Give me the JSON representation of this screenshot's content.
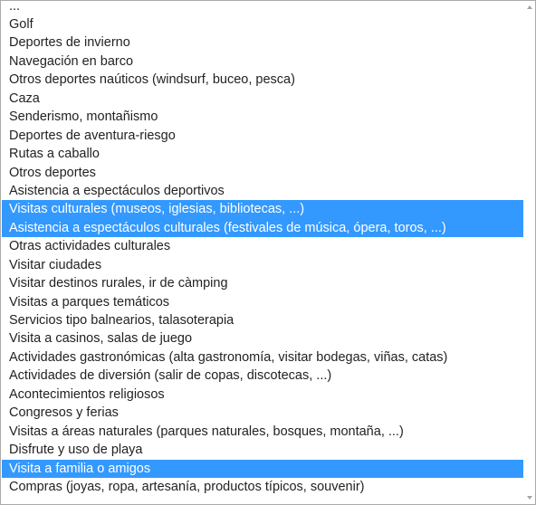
{
  "listbox": {
    "options": [
      {
        "label": "...",
        "selected": false
      },
      {
        "label": "Golf",
        "selected": false
      },
      {
        "label": "Deportes de invierno",
        "selected": false
      },
      {
        "label": "Navegación en barco",
        "selected": false
      },
      {
        "label": "Otros deportes naúticos (windsurf, buceo, pesca)",
        "selected": false
      },
      {
        "label": "Caza",
        "selected": false
      },
      {
        "label": "Senderismo, montañismo",
        "selected": false
      },
      {
        "label": "Deportes de aventura-riesgo",
        "selected": false
      },
      {
        "label": "Rutas a caballo",
        "selected": false
      },
      {
        "label": "Otros deportes",
        "selected": false
      },
      {
        "label": "Asistencia a espectáculos deportivos",
        "selected": false
      },
      {
        "label": "Visitas culturales (museos, iglesias, bibliotecas, ...)",
        "selected": true
      },
      {
        "label": "Asistencia a espectáculos culturales (festivales de música, ópera, toros, ...)",
        "selected": true
      },
      {
        "label": "Otras actividades culturales",
        "selected": false
      },
      {
        "label": "Visitar ciudades",
        "selected": false
      },
      {
        "label": "Visitar destinos rurales, ir de càmping",
        "selected": false
      },
      {
        "label": "Visitas a parques temáticos",
        "selected": false
      },
      {
        "label": "Servicios tipo balnearios, talasoterapia",
        "selected": false
      },
      {
        "label": "Visita a casinos, salas de juego",
        "selected": false
      },
      {
        "label": "Actividades gastronómicas (alta gastronomía, visitar bodegas, viñas, catas)",
        "selected": false
      },
      {
        "label": "Actividades de diversión (salir de copas, discotecas, ...)",
        "selected": false
      },
      {
        "label": "Acontecimientos religiosos",
        "selected": false
      },
      {
        "label": "Congresos y ferias",
        "selected": false
      },
      {
        "label": "Visitas a áreas naturales (parques naturales, bosques, montaña, ...)",
        "selected": false
      },
      {
        "label": "Disfrute y uso de playa",
        "selected": false
      },
      {
        "label": "Visita a familia o amigos",
        "selected": true
      },
      {
        "label": "Compras (joyas, ropa, artesanía, productos típicos, souvenir)",
        "selected": false
      }
    ]
  },
  "scrollbar": {
    "up_icon": "arrow-up-icon",
    "down_icon": "arrow-down-icon"
  },
  "colors": {
    "selection": "#3399ff",
    "text": "#222222",
    "border": "#a9a9a9"
  }
}
